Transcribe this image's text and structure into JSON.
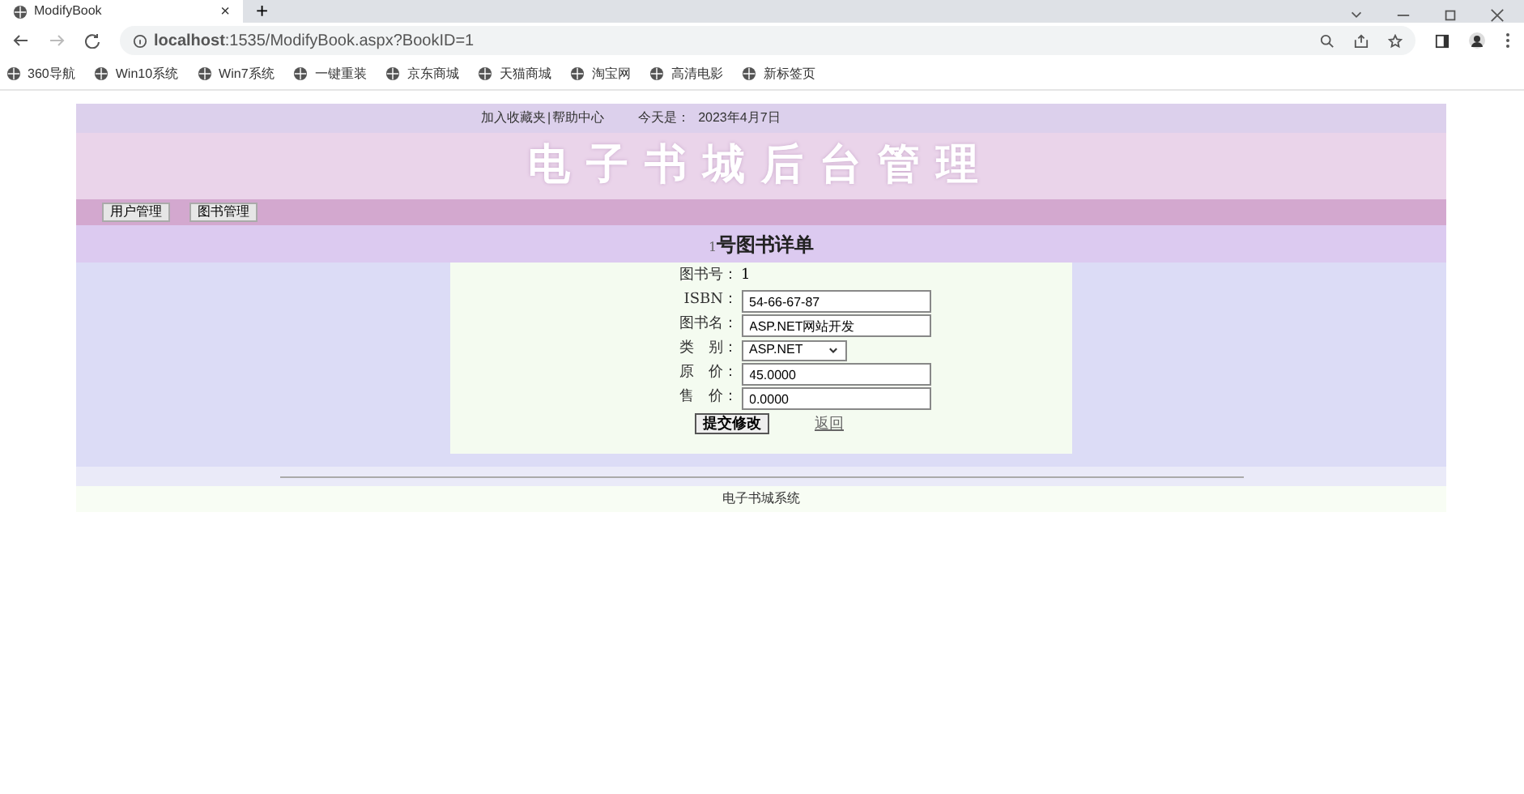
{
  "browser": {
    "tabs": [
      {
        "title": "ModifyBook",
        "selected": true
      }
    ],
    "close_tab": "×",
    "new_tab": "+",
    "address": "**localhost**:1535/ModifyBook.aspx?BookID=1",
    "bookmarks": [
      "360导航",
      "Win10系统",
      "Win7系统",
      "一键重装",
      "京东商城",
      "天猫商城",
      "淘宝网",
      "高清电影",
      "新标签页"
    ]
  },
  "page": {
    "top_links": [
      "加入收藏夹",
      "帮助中心"
    ],
    "separator": "|",
    "date_label": "今天是：",
    "date": "2023年4月7日",
    "banner_title": "电子书城后台管理",
    "nav": [
      {
        "label": "用户管理"
      },
      {
        "label": "图书管理"
      }
    ],
    "heading": {
      "number": "1",
      "text": "号图书详单"
    },
    "form": [
      {
        "kind": "text",
        "label": "图书号：",
        "value": "1"
      },
      {
        "kind": "input",
        "label": "ISBN：",
        "value": "54-66-67-87"
      },
      {
        "kind": "input",
        "label": "图书名：",
        "value": "ASP.NET网站开发"
      },
      {
        "kind": "select",
        "label": "类　别：",
        "value": "ASP.NET"
      },
      {
        "kind": "input",
        "label": "原　价：",
        "value": "45.0000"
      },
      {
        "kind": "input",
        "label": "售　价：",
        "value": "0.0000"
      }
    ],
    "submit": "提交修改",
    "back": "返回",
    "footer": "电子书城系统"
  }
}
